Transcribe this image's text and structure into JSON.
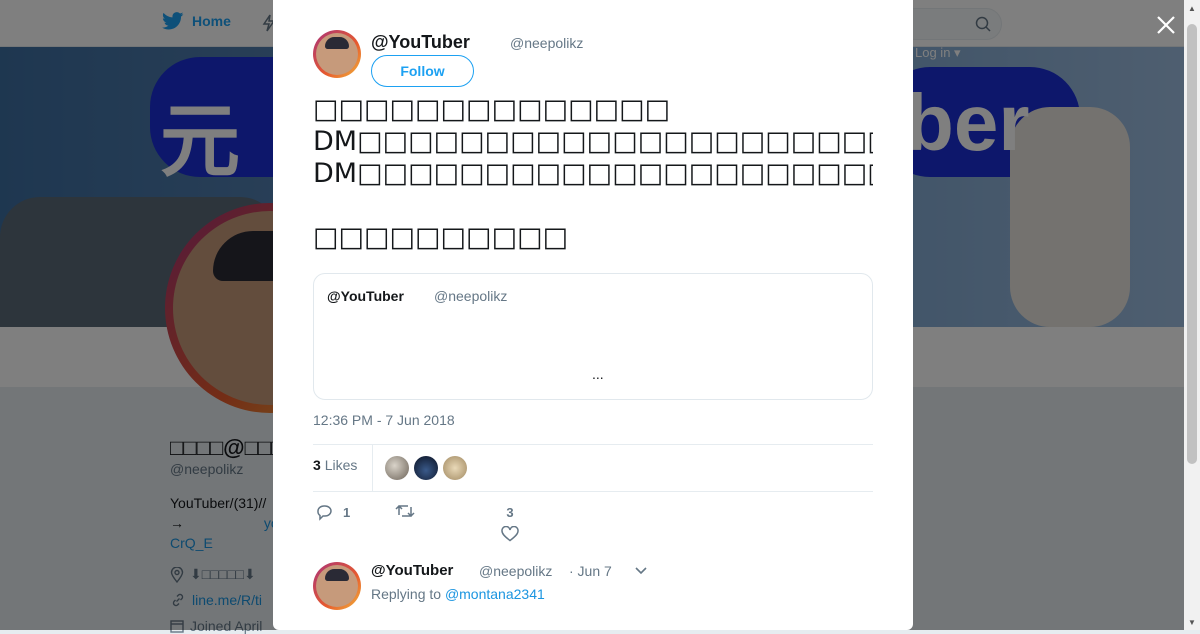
{
  "nav": {
    "home_label": "Home",
    "login_label": "Log in ▾"
  },
  "banner": {
    "left_text": "元",
    "right_text": "ber"
  },
  "profile": {
    "name": "□□□□@□□□",
    "handle": "@neepolikz",
    "bio_line1": "YouTuber/(31)//",
    "bio_arrow": "→",
    "bio_link": "yo",
    "bio_line3": "CrQ_E",
    "location": "⬇□□□□□⬇",
    "url": "line.me/R/ti",
    "joined": "Joined April"
  },
  "tweet": {
    "name": "@YouTuber",
    "handle": "@neepolikz",
    "follow_label": "Follow",
    "lines": [
      "□□□□□□□□□□□□□□",
      "DM□□□□□□□□□□□□□□□□□□□□□□□□□",
      "DM□□□□□□□□□□□□□□□□□□□□□□□□□",
      "",
      "□□□□□□□□□□"
    ],
    "quote": {
      "name": "@YouTuber",
      "handle": "@neepolikz",
      "more": "..."
    },
    "timestamp": "12:36 PM - 7 Jun 2018",
    "likes_count": "3",
    "likes_label": "Likes",
    "reply_count": "1",
    "like_count": "3"
  },
  "reply": {
    "name": "@YouTuber",
    "handle": "@neepolikz",
    "date": "· Jun 7",
    "replying_prefix": "Replying to",
    "replying_to": "@montana2341"
  },
  "colors": {
    "accent": "#1da1f2",
    "link": "#1b95e0",
    "muted": "#657786"
  }
}
